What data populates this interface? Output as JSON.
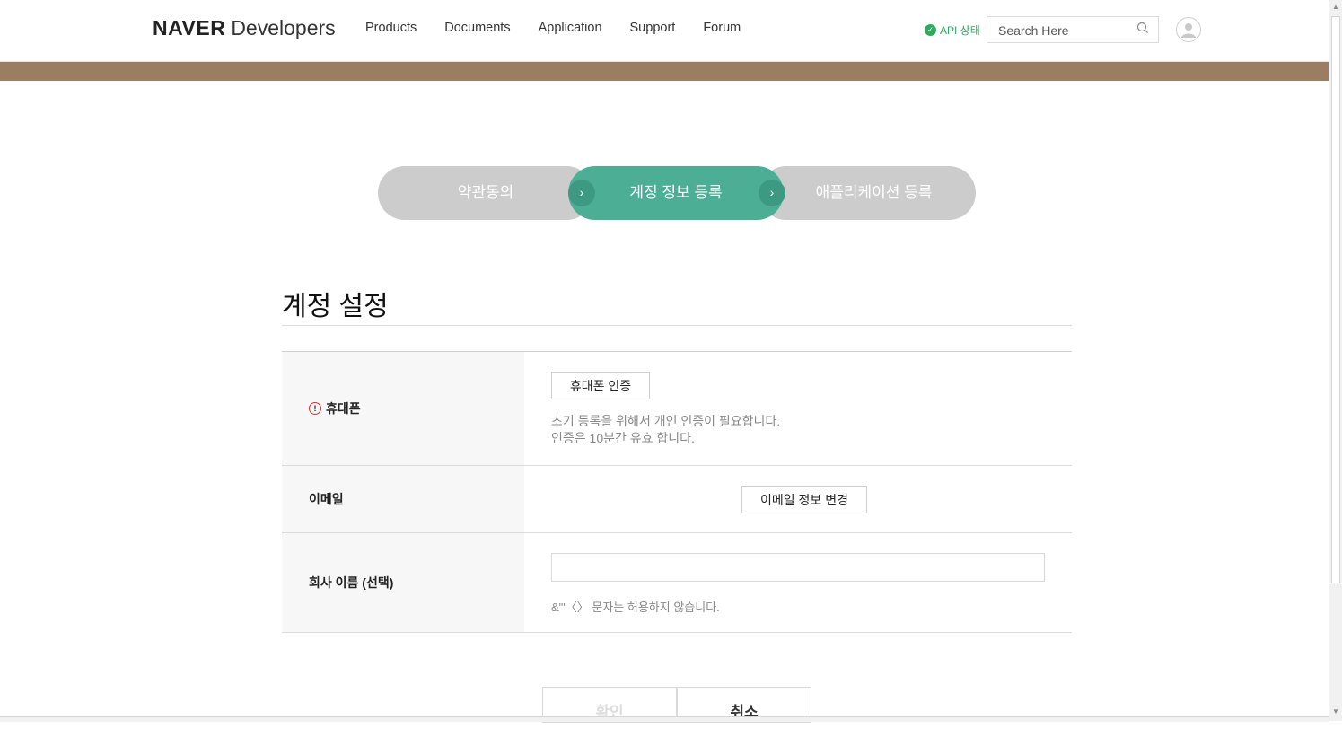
{
  "header": {
    "logo_bold": "NAVER",
    "logo_light": "Developers",
    "nav": [
      "Products",
      "Documents",
      "Application",
      "Support",
      "Forum"
    ],
    "api_status": "API 상태",
    "search_placeholder": "Search Here"
  },
  "steps": {
    "step1": "약관동의",
    "step2": "계정 정보 등록",
    "step3": "애플리케이션 등록",
    "arrow": "›"
  },
  "section": {
    "title": "계정 설정",
    "rows": {
      "phone": {
        "label": "휴대폰",
        "required_icon": "!",
        "button": "휴대폰 인증",
        "help_line1": "초기 등록을 위해서 개인 인증이 필요합니다.",
        "help_line2": "인증은 10분간 유효 합니다."
      },
      "email": {
        "label": "이메일",
        "button": "이메일 정보 변경"
      },
      "company": {
        "label": "회사 이름 (선택)",
        "value": "",
        "help": "&\"'〈〉 문자는 허용하지 않습니다."
      }
    }
  },
  "actions": {
    "confirm": "확인",
    "cancel": "취소"
  },
  "colors": {
    "banner": "#9b7e61",
    "step_active": "#4caf95",
    "step_inactive": "#cccccc",
    "required": "#e02d2d",
    "api_ok": "#2eaa5c"
  }
}
